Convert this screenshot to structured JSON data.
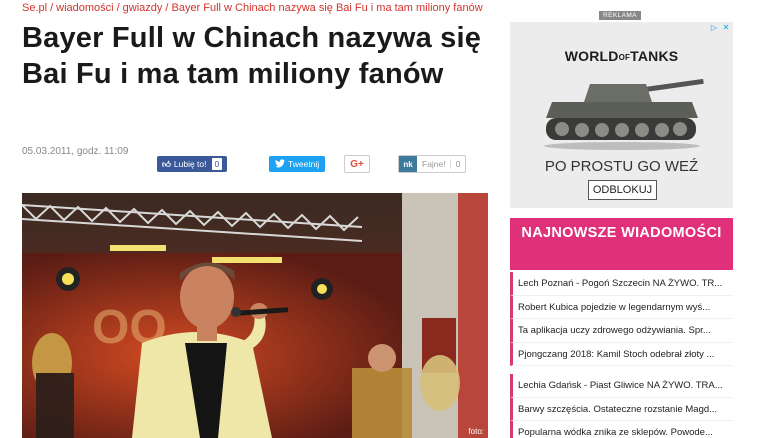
{
  "breadcrumb": {
    "items": [
      "Se.pl",
      "wiadomości",
      "gwiazdy",
      "Bayer Full w Chinach nazywa się Bai Fu i ma tam miliony fanów"
    ],
    "separator": "/"
  },
  "article": {
    "title": "Bayer Full w Chinach nazywa się Bai Fu i ma tam miliony fanów",
    "date": "05.03.2011, godz. 11:09",
    "photo_credit": "foto:"
  },
  "share": {
    "facebook_label": "Lubię to!",
    "facebook_count": "0",
    "twitter_label": "Tweetnij",
    "gplus_label": "G+",
    "nk_logo": "nk",
    "nk_label": "Fajne!",
    "nk_count": "0"
  },
  "ad": {
    "label": "REKLAMA",
    "brand_pre": "WORLD",
    "brand_of": "OF",
    "brand_post": "TANKS",
    "slogan": "PO PROSTU GO WEŹ",
    "button": "ODBLOKUJ",
    "corner_icons": [
      "ad-choices-icon",
      "close-icon"
    ]
  },
  "news": {
    "heading": "NAJNOWSZE WIADOMOŚCI",
    "items": [
      "Lech Poznań - Pogoń Szczecin NA ŻYWO. TR...",
      "Robert Kubica pojedzie w legendarnym wyś...",
      "Ta aplikacja uczy zdrowego odżywiania. Spr...",
      "Pjongczang 2018: Kamil Stoch odebrał złoty ...",
      "Lechia Gdańsk - Piast Gliwice NA ŻYWO. TRA...",
      "Barwy szczęścia. Ostateczne rozstanie Magd...",
      "Popularna wódka znika ze sklepów. Powode..."
    ]
  },
  "colors": {
    "accent_red": "#d0342c",
    "news_pink": "#e0307a",
    "facebook": "#3b5998",
    "twitter": "#1da1f2"
  }
}
